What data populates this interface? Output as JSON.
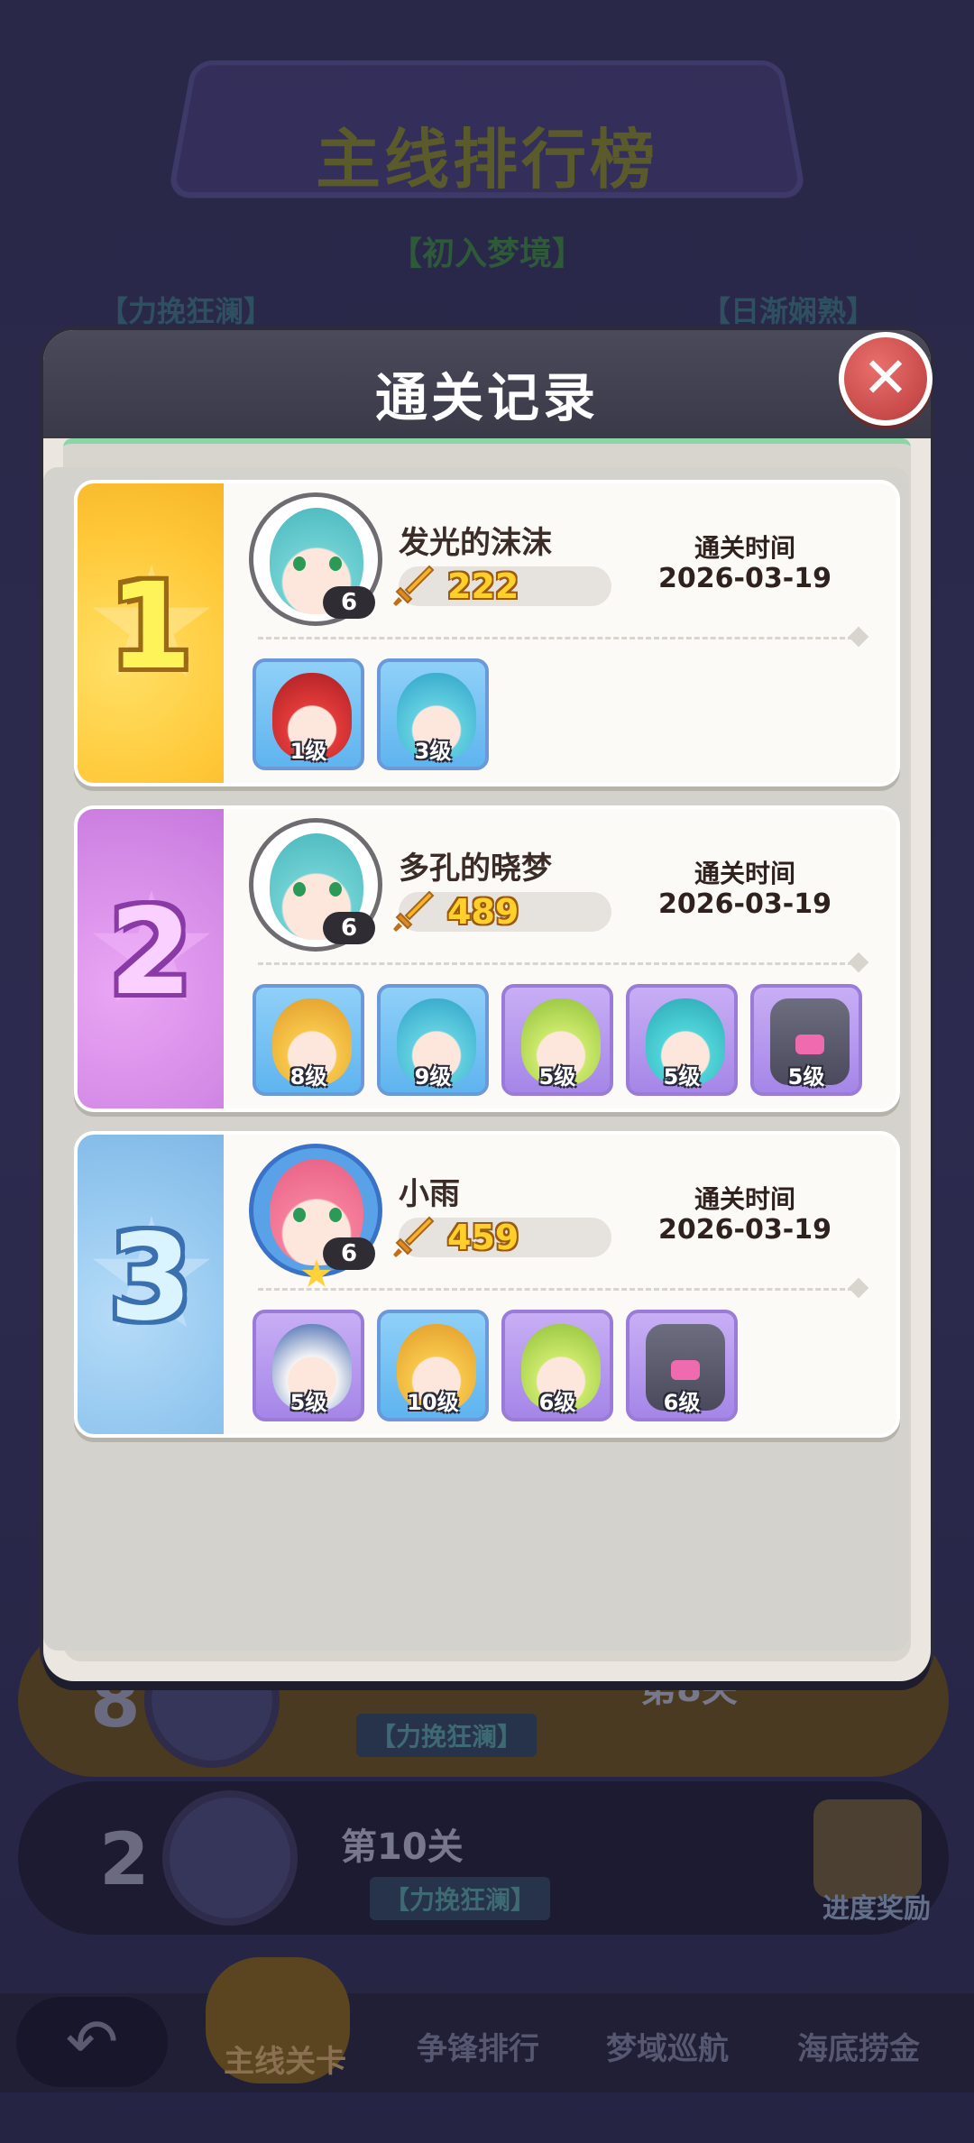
{
  "background": {
    "banner_title": "主线排行榜",
    "subtitle": "【初入梦境】",
    "tag_left": "【力挽狂澜】",
    "tag_right": "【日渐娴熟】",
    "rows": [
      {
        "rank": "8",
        "stage": "第8关",
        "chip": "【力挽狂澜】"
      },
      {
        "rank": "2",
        "stage": "第10关",
        "chip": "【力挽狂澜】",
        "gift_label": "进度奖励"
      }
    ],
    "nav": {
      "back_glyph": "↶",
      "main_stage": "主线关卡",
      "items": [
        "争锋排行",
        "梦域巡航",
        "海底捞金"
      ]
    }
  },
  "modal": {
    "title": "通关记录",
    "close_glyph": "✕",
    "clear_time_label": "通关时间",
    "records": [
      {
        "rank": "1",
        "player_name": "发光的沫沫",
        "level": "6",
        "power": "222",
        "date": "2026-03-19",
        "heroes": [
          {
            "level": "1级",
            "art": "red"
          },
          {
            "level": "3级",
            "art": "teal"
          }
        ]
      },
      {
        "rank": "2",
        "player_name": "多孔的晓梦",
        "level": "6",
        "power": "489",
        "date": "2026-03-19",
        "heroes": [
          {
            "level": "8级",
            "art": "blonde"
          },
          {
            "level": "9级",
            "art": "teal"
          },
          {
            "level": "5级",
            "art": "lime"
          },
          {
            "level": "5级",
            "art": "aqua"
          },
          {
            "level": "5级",
            "art": "robot"
          }
        ]
      },
      {
        "rank": "3",
        "player_name": "小雨",
        "level": "6",
        "power": "459",
        "date": "2026-03-19",
        "heroes": [
          {
            "level": "5级",
            "art": "white"
          },
          {
            "level": "10级",
            "art": "blonde"
          },
          {
            "level": "6级",
            "art": "lime"
          },
          {
            "level": "6级",
            "art": "robot"
          }
        ]
      }
    ]
  },
  "colors": {
    "rank1": "#ffc93a",
    "rank2": "#d58ce7",
    "rank3": "#93c7ef",
    "close": "#c84a4a",
    "power_text": "#ffd02a"
  }
}
